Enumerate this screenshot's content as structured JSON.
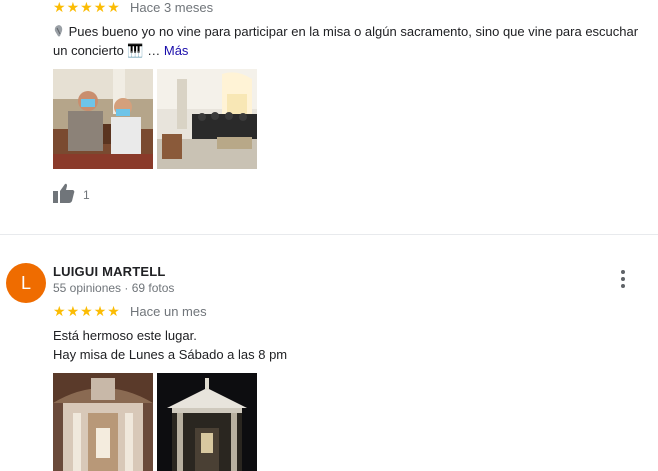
{
  "review1": {
    "time": "Hace 3 meses",
    "text": "Pues bueno yo no vine para participar en la misa o algún sacramento, sino que vine para escuchar un concierto 🎹 …",
    "more": "Más",
    "likes": "1",
    "rating": 5,
    "photo_icons": [
      "people-masks-photo",
      "church-concert-photo"
    ]
  },
  "review2": {
    "avatar_letter": "L",
    "avatar_color": "#ef6c00",
    "name": "LUIGUI MARTELL",
    "stats": "55 opiniones · 69 fotos",
    "time": "Hace un mes",
    "rating": 5,
    "line1": "Está hermoso este lugar.",
    "line2": "Hay misa de Lunes a Sábado a las 8 pm"
  },
  "colors": {
    "star": "#fbbc04",
    "link": "#1a0dab",
    "muted": "#70757a"
  }
}
